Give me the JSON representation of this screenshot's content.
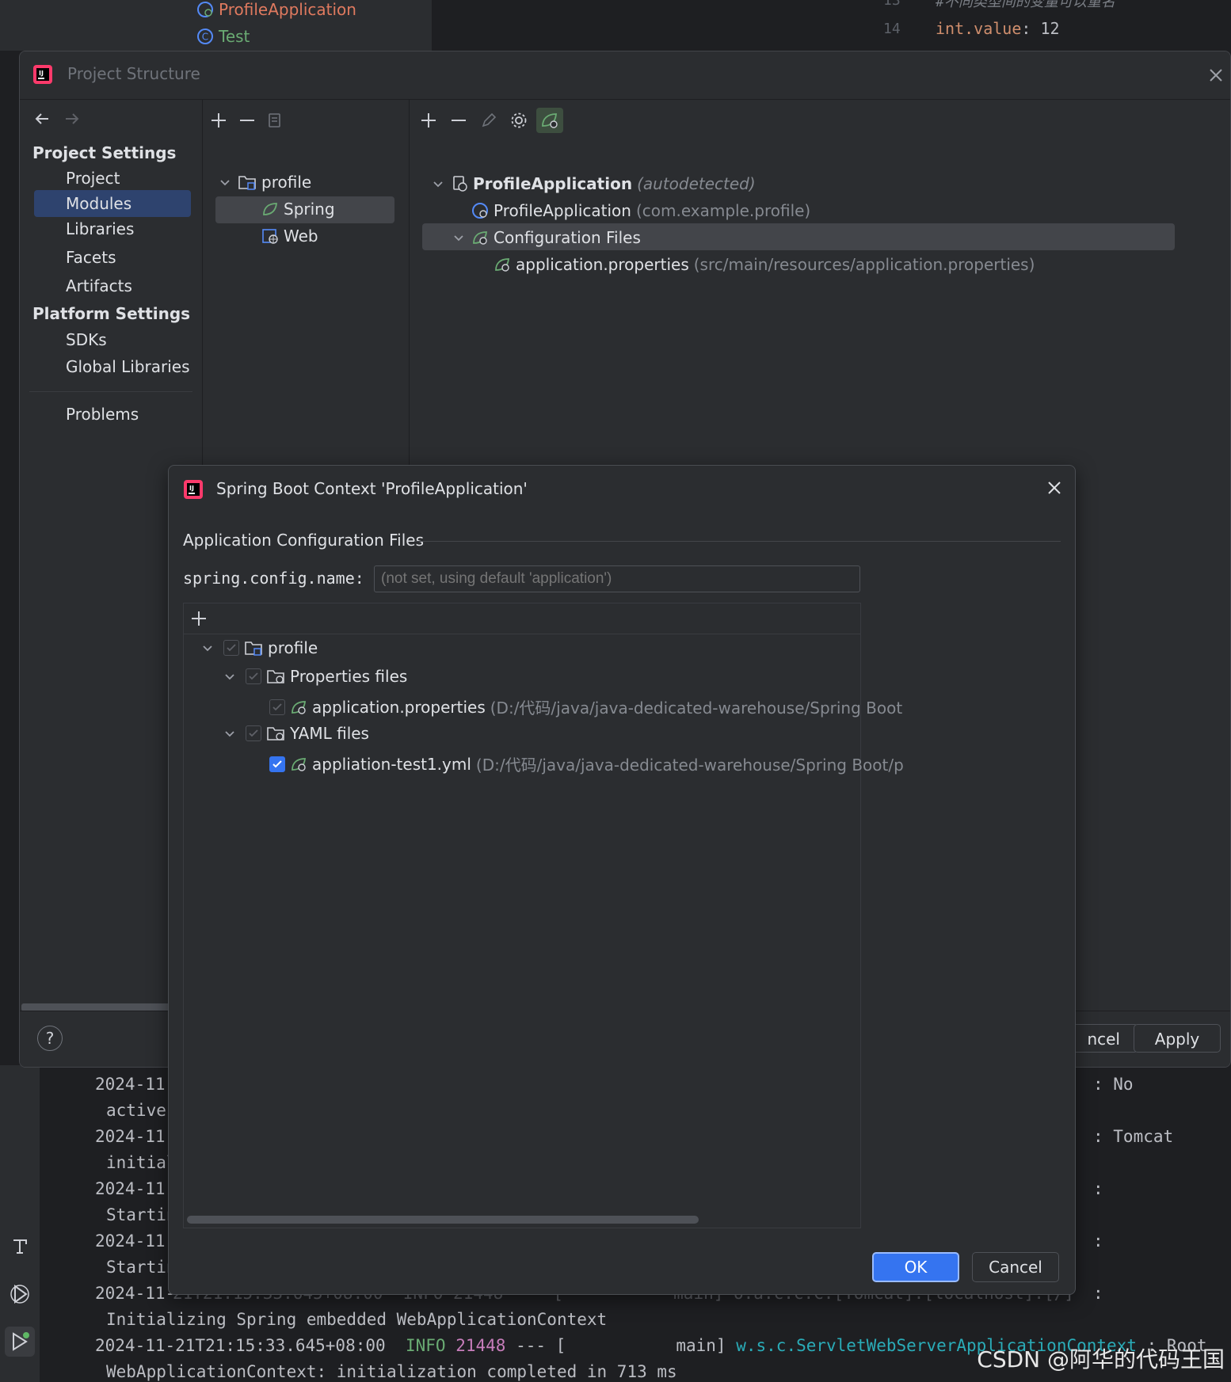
{
  "background_ide": {
    "tree_items": [
      {
        "label": "ProfileApplication",
        "color": "#e07a5f"
      },
      {
        "label": "Test",
        "color": "#6aab73"
      }
    ],
    "editor": {
      "line_numbers": [
        "13",
        "14"
      ],
      "comment_line": "#不同类型间的变量可以重名",
      "code_key": "int.value",
      "code_sep": ":",
      "code_value": "12"
    }
  },
  "project_structure": {
    "title": "Project Structure",
    "nav": {
      "platform_heading": "Platform Settings",
      "project_heading": "Project Settings",
      "project_items": [
        "Project",
        "Modules",
        "Libraries",
        "Facets",
        "Artifacts"
      ],
      "platform_items": [
        "SDKs",
        "Global Libraries"
      ],
      "problems": "Problems",
      "selected": "Modules"
    },
    "modules_tree": {
      "root": "profile",
      "children": [
        "Spring",
        "Web"
      ],
      "selected": "Spring"
    },
    "spring_tree": {
      "app_name": "ProfileApplication",
      "app_suffix": "(autodetected)",
      "class_name": "ProfileApplication",
      "class_package": "(com.example.profile)",
      "config_files": "Configuration Files",
      "file_name": "application.properties",
      "file_path": "(src/main/resources/application.properties)"
    },
    "buttons": {
      "cancel_partial": "ncel",
      "apply": "Apply",
      "help": "?"
    }
  },
  "dialog": {
    "title": "Spring Boot Context 'ProfileApplication'",
    "section_title": "Application Configuration Files",
    "config_name_label": "spring.config.name:",
    "config_name_placeholder": "(not set, using default 'application')",
    "tree": {
      "root": "profile",
      "properties_group": "Properties files",
      "properties_file": "application.properties",
      "properties_path": "(D:/代码/java/java-dedicated-warehouse/Spring Boot",
      "yaml_group": "YAML files",
      "yaml_file": "appliation-test1.yml",
      "yaml_path": "(D:/代码/java/java-dedicated-warehouse/Spring Boot/p",
      "yaml_checked": true
    },
    "ok": "OK",
    "cancel": "Cancel"
  },
  "console": {
    "left_col": [
      "2024-11-",
      "active",
      "2024-11-",
      "initial",
      "2024-11-",
      "Startin",
      "2024-11-",
      "Startin",
      "2024-11-"
    ],
    "left_col_tail": "21T21:15:33.645+08:00  INFO 21448 --- [           main] o.a.c.c.C.[Tomcat].[localhost].[/]",
    "right_col": [
      ": No",
      ": Tomcat",
      ":",
      ":",
      ":"
    ],
    "line_a": "Initializing Spring embedded WebApplicationContext",
    "line_b_ts": "2024-11-21T21:15:33.645+08:00",
    "line_b_level": "INFO",
    "line_b_pid": "21448",
    "line_b_mid": "--- [           main]",
    "line_b_logger": "w.s.c.ServletWebServerApplicationContext",
    "line_b_tail": ": Root",
    "line_c": "WebApplicationContext: initialization completed in 713 ms"
  },
  "watermark": "CSDN @阿华的代码王国",
  "colors": {
    "accent": "#3574f0",
    "selection": "#2e436e",
    "spring_green": "#6aab73"
  }
}
